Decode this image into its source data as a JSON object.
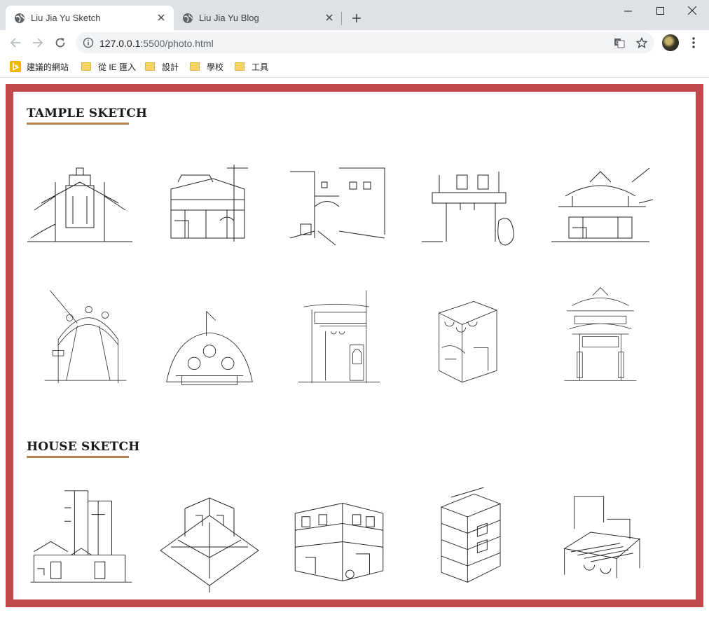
{
  "browser": {
    "tabs": [
      {
        "title": "Liu Jia Yu Sketch",
        "active": true
      },
      {
        "title": "Liu Jia Yu Blog",
        "active": false
      }
    ],
    "url": {
      "host": "127.0.0.1",
      "rest": ":5500/photo.html"
    },
    "bookmarks": [
      {
        "label": "建議的網站",
        "icon": "bing-icon"
      },
      {
        "label": "從 IE 匯入",
        "icon": "folder-icon"
      },
      {
        "label": "設計",
        "icon": "folder-icon"
      },
      {
        "label": "學校",
        "icon": "folder-icon"
      },
      {
        "label": "工具",
        "icon": "folder-icon"
      }
    ]
  },
  "page": {
    "frame_color": "#c1484b",
    "accent_color": "#b48552",
    "sections": [
      {
        "title": "TAMPLE SKETCH",
        "image_count": 10
      },
      {
        "title": "HOUSE SKETCH",
        "image_count": 5
      }
    ]
  }
}
